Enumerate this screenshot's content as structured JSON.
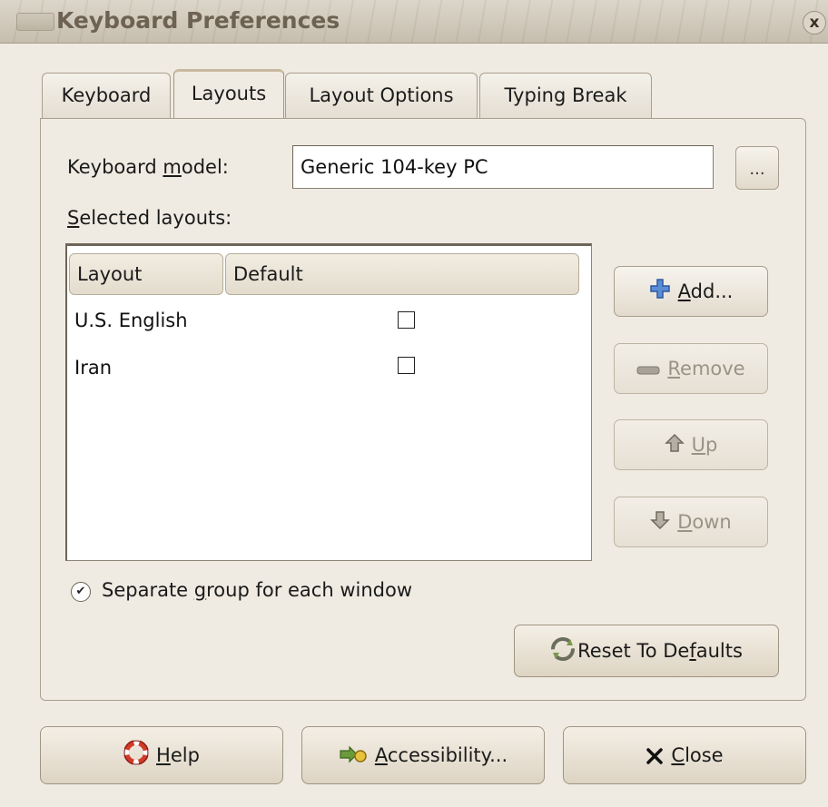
{
  "window": {
    "title": "Keyboard Preferences",
    "close_glyph": "x"
  },
  "tabs": [
    {
      "label": "Keyboard",
      "active": false
    },
    {
      "label": "Layouts",
      "active": true
    },
    {
      "label": "Layout Options",
      "active": false
    },
    {
      "label": "Typing Break",
      "active": false
    }
  ],
  "layouts_tab": {
    "model_label_pre": "Keyboard ",
    "model_label_mnemonic": "m",
    "model_label_post": "odel:",
    "model_value": "Generic 104-key PC",
    "model_browse_label": "...",
    "selected_label_mnemonic": "S",
    "selected_label_post": "elected layouts:",
    "columns": [
      "Layout",
      "Default"
    ],
    "rows": [
      {
        "layout": "U.S. English",
        "default": false
      },
      {
        "layout": "Iran",
        "default": false
      }
    ],
    "buttons": {
      "add": {
        "mnemonic": "A",
        "rest": "dd...",
        "enabled": true,
        "icon": "plus-icon"
      },
      "remove": {
        "mnemonic": "R",
        "rest": "emove",
        "enabled": false,
        "icon": "minus-icon"
      },
      "up": {
        "mnemonic": "U",
        "rest": "p",
        "enabled": false,
        "icon": "arrow-up-icon"
      },
      "down": {
        "mnemonic": "D",
        "rest": "own",
        "enabled": false,
        "icon": "arrow-down-icon"
      }
    },
    "separate_group": {
      "pre": "Separate ",
      "mnemonic": "g",
      "post": "roup for each window",
      "checked": true
    },
    "reset": {
      "pre": "Reset To De",
      "mnemonic": "f",
      "post": "aults",
      "icon": "refresh-icon"
    }
  },
  "footer": {
    "help": {
      "mnemonic": "H",
      "rest": "elp",
      "icon": "lifebuoy-icon"
    },
    "accessibility": {
      "mnemonic": "A",
      "rest": "ccessibility...",
      "icon": "accessibility-icon"
    },
    "close": {
      "mnemonic": "C",
      "rest": "lose",
      "icon": "close-icon"
    }
  },
  "colors": {
    "window_bg": "#efebe2",
    "accent_blue": "#3a6fc4",
    "disabled_text": "#9a9284"
  }
}
